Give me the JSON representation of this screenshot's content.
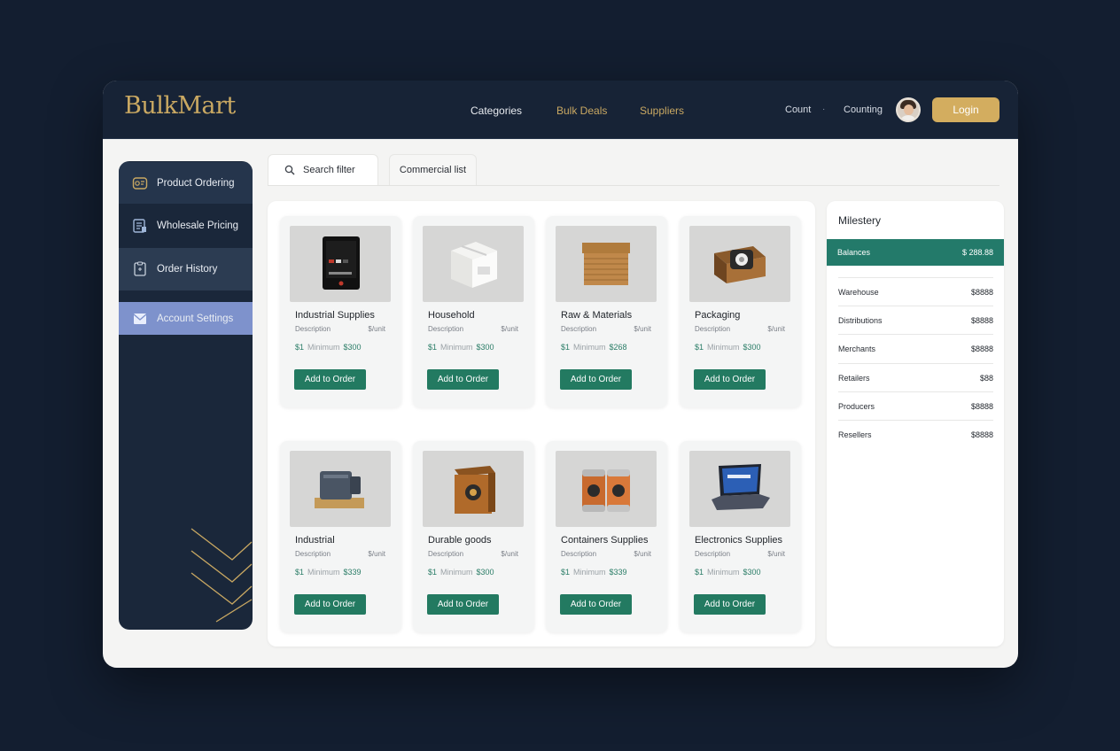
{
  "header": {
    "brand": "BulkMart",
    "nav": [
      "Categories",
      "Bulk Deals",
      "Suppliers"
    ],
    "count_label": "Count",
    "separator": "·",
    "counting_label": "Counting",
    "login": "Login"
  },
  "sidebar": {
    "items": [
      {
        "label": "Product Ordering",
        "icon": "box-icon"
      },
      {
        "label": "Wholesale Pricing",
        "icon": "tag-list-icon"
      },
      {
        "label": "Order History",
        "icon": "receipt-icon"
      },
      {
        "label": "Account Settings",
        "icon": "mail-icon",
        "active": true
      }
    ]
  },
  "tabs": [
    {
      "label": "Search filter",
      "icon": "search-icon"
    },
    {
      "label": "Commercial list"
    }
  ],
  "products": [
    {
      "name": "Industrial Supplies",
      "sub": "Description",
      "unit": "$/unit",
      "qty": "$1",
      "min": "Minimum",
      "price": "$300",
      "button": "Add to Order",
      "image": "device-icon"
    },
    {
      "name": "Household",
      "sub": "Description",
      "unit": "$/unit",
      "qty": "$1",
      "min": "Minimum",
      "price": "$300",
      "button": "Add to Order",
      "image": "white-box-icon"
    },
    {
      "name": "Raw & Materials",
      "sub": "Description",
      "unit": "$/unit",
      "qty": "$1",
      "min": "Minimum",
      "price": "$268",
      "button": "Add to Order",
      "image": "crate-icon"
    },
    {
      "name": "Packaging",
      "sub": "Description",
      "unit": "$/unit",
      "qty": "$1",
      "min": "Minimum",
      "price": "$300",
      "button": "Add to Order",
      "image": "tape-box-icon"
    },
    {
      "name": "Industrial",
      "sub": "Description",
      "unit": "$/unit",
      "qty": "$1",
      "min": "Minimum",
      "price": "$339",
      "button": "Add to Order",
      "image": "machine-icon"
    },
    {
      "name": "Durable goods",
      "sub": "Description",
      "unit": "$/unit",
      "qty": "$1",
      "min": "Minimum",
      "price": "$300",
      "button": "Add to Order",
      "image": "safe-box-icon"
    },
    {
      "name": "Containers Supplies",
      "sub": "Description",
      "unit": "$/unit",
      "qty": "$1",
      "min": "Minimum",
      "price": "$339",
      "button": "Add to Order",
      "image": "cans-icon"
    },
    {
      "name": "Electronics Supplies",
      "sub": "Description",
      "unit": "$/unit",
      "qty": "$1",
      "min": "Minimum",
      "price": "$300",
      "button": "Add to Order",
      "image": "laptop-icon"
    }
  ],
  "summary": {
    "title": "Milestery",
    "highlight": {
      "label": "Balances",
      "value": "$ 288.88"
    },
    "rows": [
      {
        "label": "Warehouse",
        "value": "$8888"
      },
      {
        "label": "Distributions",
        "value": "$8888"
      },
      {
        "label": "Merchants",
        "value": "$8888"
      },
      {
        "label": "Retailers",
        "value": "$88"
      },
      {
        "label": "Producers",
        "value": "$8888"
      },
      {
        "label": "Resellers",
        "value": "$8888"
      }
    ]
  }
}
